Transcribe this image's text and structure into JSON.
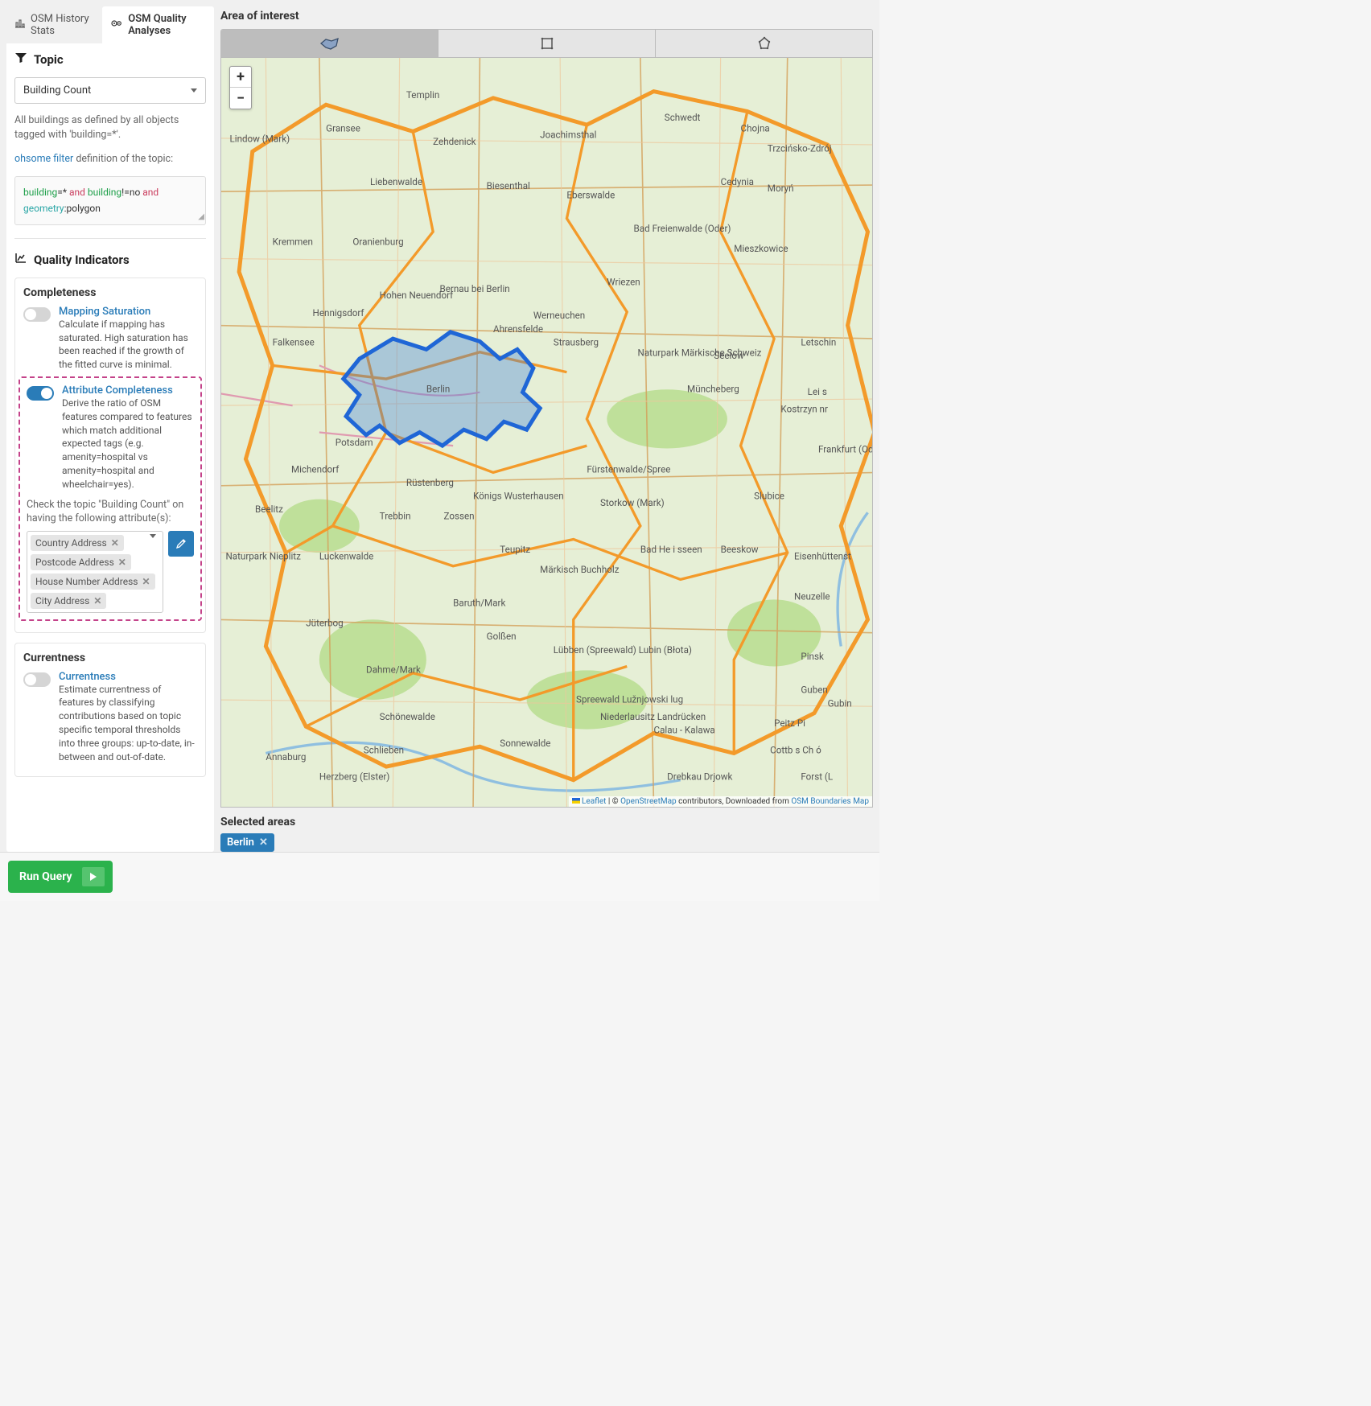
{
  "tabs": {
    "history": "OSM History Stats",
    "quality": "OSM Quality Analyses"
  },
  "topic": {
    "heading": "Topic",
    "selected": "Building Count",
    "desc": "All buildings as defined by all objects tagged with 'building=*'.",
    "filter_link": "ohsome filter",
    "filter_suffix": " definition of the topic:",
    "code": {
      "t1": "building",
      "t2": "=*",
      "t3": " and ",
      "t4": "building",
      "t5": "!=no",
      "t6": " and",
      "t7": "geometry",
      "t8": ":polygon"
    }
  },
  "quality": {
    "heading": "Quality Indicators",
    "completeness": {
      "title": "Completeness",
      "ms": {
        "title": "Mapping Saturation",
        "desc": "Calculate if mapping has saturated. High saturation has been reached if the growth of the fitted curve is minimal."
      },
      "ac": {
        "title": "Attribute Completeness",
        "desc": "Derive the ratio of OSM features compared to features which match additional expected tags (e.g. amenity=hospital vs amenity=hospital and wheelchair=yes).",
        "prompt": "Check the topic \"Building Count\" on having the following attribute(s):",
        "chips": [
          "Country Address",
          "Postcode Address",
          "House Number Address",
          "City Address"
        ]
      }
    },
    "currentness": {
      "title": "Currentness",
      "ind": {
        "title": "Currentness",
        "desc": "Estimate currentness of features by classifying contributions based on topic specific temporal thresholds into three groups: up-to-date, in-between and out-of-date."
      }
    }
  },
  "aoi": {
    "heading": "Area of interest",
    "selected_heading": "Selected areas",
    "areas": [
      "Berlin"
    ]
  },
  "attribution": {
    "leaflet": "Leaflet",
    "sep": " | © ",
    "osm": "OpenStreetMap",
    "mid": " contributors, Downloaded from ",
    "bnd": "OSM Boundaries Map"
  },
  "run_label": "Run Query"
}
